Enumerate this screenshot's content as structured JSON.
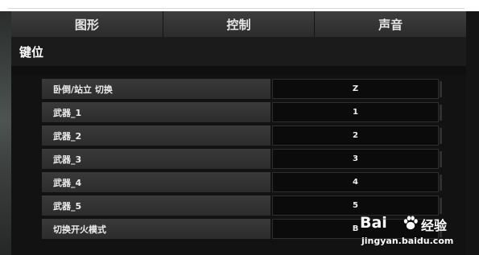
{
  "tabs": [
    {
      "label": "图形"
    },
    {
      "label": "控制"
    },
    {
      "label": "声音"
    }
  ],
  "section": {
    "title": "键位"
  },
  "bindings": [
    {
      "action": "卧倒/站立 切换",
      "key": "Z"
    },
    {
      "action": "武器_1",
      "key": "1"
    },
    {
      "action": "武器_2",
      "key": "2"
    },
    {
      "action": "武器_3",
      "key": "3"
    },
    {
      "action": "武器_4",
      "key": "4"
    },
    {
      "action": "武器_5",
      "key": "5"
    },
    {
      "action": "切换开火模式",
      "key": "B"
    }
  ],
  "watermark": {
    "brand": "Bai",
    "brand_suffix": "经验",
    "domain": "jingyan.baidu.com",
    "icon": "paw-icon"
  },
  "colors": {
    "panel": "#121212",
    "tab": "#333333",
    "row": "#333333",
    "key_field": "#0b0b0b"
  }
}
